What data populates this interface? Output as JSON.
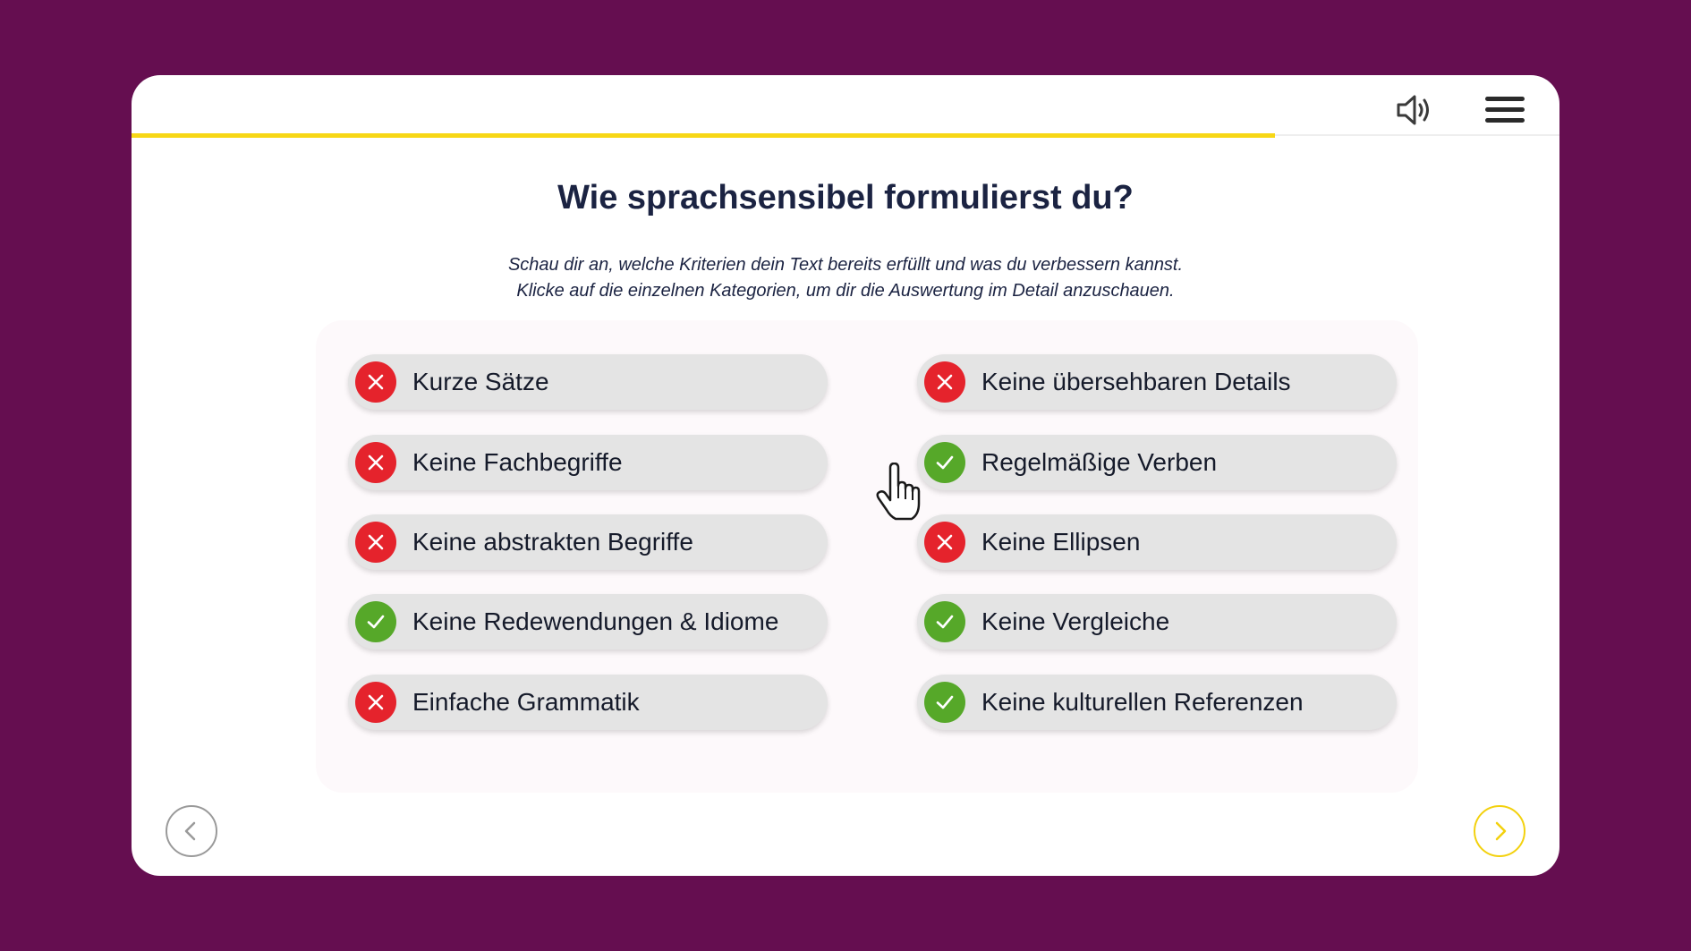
{
  "header": {
    "progress_fraction": 0.801,
    "sound_icon": "speaker-icon",
    "menu_icon": "hamburger-menu-icon"
  },
  "main": {
    "title": "Wie sprachsensibel formulierst du?",
    "subtitle_line1": "Schau dir an, welche Kriterien dein Text bereits erfüllt und was du verbessern kannst.",
    "subtitle_line2": "Klicke auf die einzelnen Kategorien, um dir die Auswertung im Detail anzuschauen."
  },
  "criteria": [
    {
      "label": "Kurze Sätze",
      "status": "fail"
    },
    {
      "label": "Keine übersehbaren Details",
      "status": "fail"
    },
    {
      "label": "Keine Fachbegriffe",
      "status": "fail"
    },
    {
      "label": "Regelmäßige Verben",
      "status": "pass"
    },
    {
      "label": "Keine abstrakten Begriffe",
      "status": "fail"
    },
    {
      "label": "Keine Ellipsen",
      "status": "fail"
    },
    {
      "label": "Keine Redewendungen & Idiome",
      "status": "pass"
    },
    {
      "label": "Keine Vergleiche",
      "status": "pass"
    },
    {
      "label": "Einfache Grammatik",
      "status": "fail"
    },
    {
      "label": "Keine kulturellen Referenzen",
      "status": "pass"
    }
  ],
  "navigation": {
    "prev_icon": "chevron-left-icon",
    "next_icon": "chevron-right-icon"
  },
  "colors": {
    "background": "#650e50",
    "accent_yellow": "#f7d716",
    "fail_red": "#e5232c",
    "pass_green": "#56a829",
    "title_navy": "#1b2342"
  }
}
